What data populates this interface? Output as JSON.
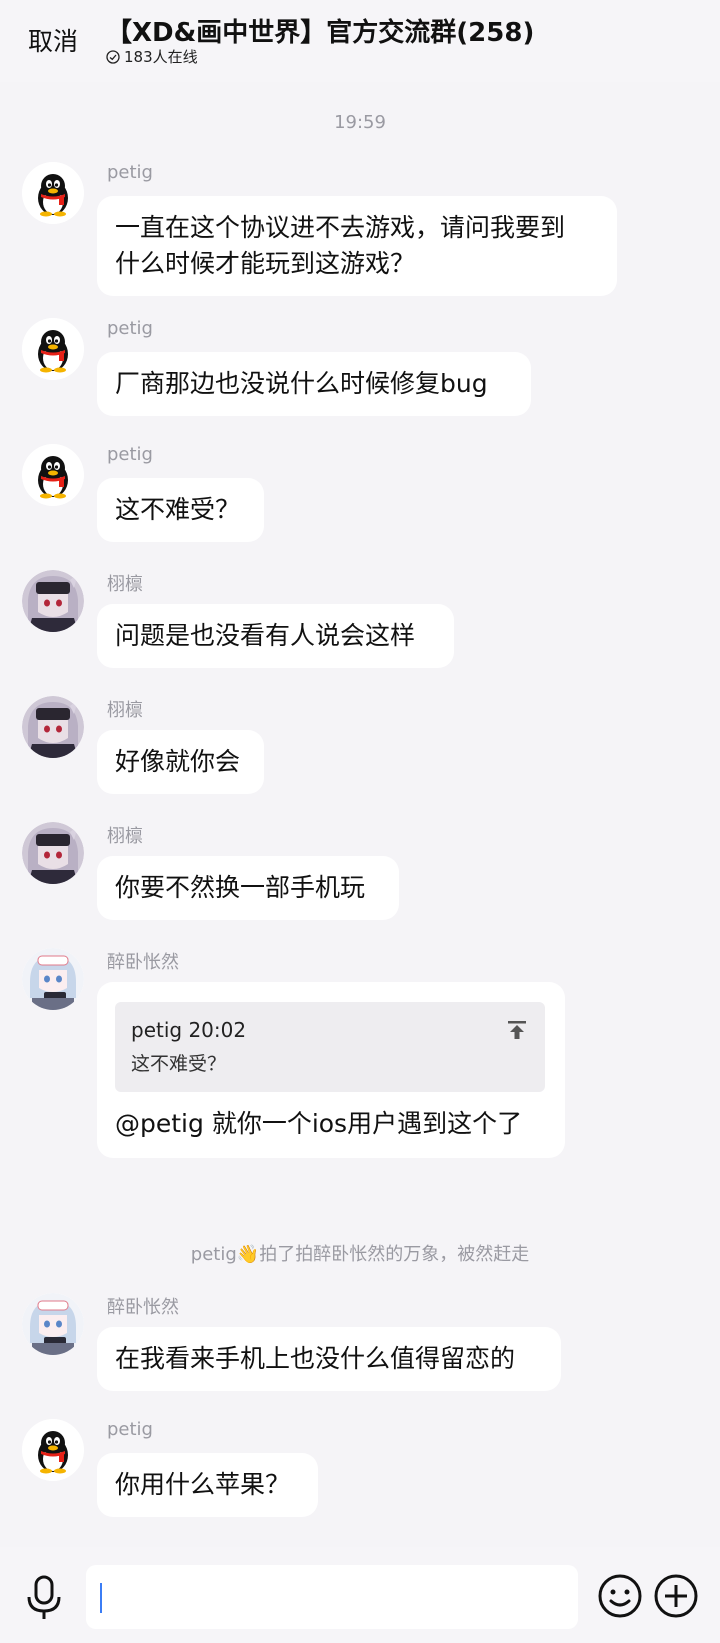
{
  "header": {
    "cancel_label": "取消",
    "title": "【XD&画中世界】官方交流群(258)",
    "online_count": "183人在线"
  },
  "timestamp": "19:59",
  "messages": [
    {
      "sender": "petig",
      "lines": [
        "一直在这个协议进不去游戏，请问我要到",
        "什么时候才能玩到这游戏？"
      ]
    },
    {
      "sender": "petig",
      "lines": [
        "厂商那边也没说什么时候修复bug"
      ]
    },
    {
      "sender": "petig",
      "lines": [
        "这不难受？"
      ]
    },
    {
      "sender": "栩檩",
      "lines": [
        "问题是也没看有人说会这样"
      ]
    },
    {
      "sender": "栩檩",
      "lines": [
        "好像就你会"
      ]
    },
    {
      "sender": "栩檩",
      "lines": [
        "你要不然换一部手机玩"
      ]
    },
    {
      "sender": "醉卧怅然",
      "quote_head": "petig 20:02",
      "quote_body": "这不难受？",
      "lines": [
        "@petig 就你一个ios用户遇到这个了"
      ]
    },
    {
      "sender": "醉卧怅然",
      "lines": [
        "在我看来手机上也没什么值得留恋的"
      ]
    },
    {
      "sender": "petig",
      "lines": [
        "你用什么苹果？"
      ]
    }
  ],
  "notice": {
    "actor": "petig",
    "action": "拍了拍醉卧怅然的万象，被然赶走"
  },
  "input": {
    "value": ""
  },
  "icons": {
    "mic": "microphone-icon",
    "emoji": "emoji-icon",
    "plus": "plus-icon"
  },
  "colors": {
    "background": "#f5f4f7",
    "bubble": "#ffffff",
    "caret": "#3b7df5"
  }
}
